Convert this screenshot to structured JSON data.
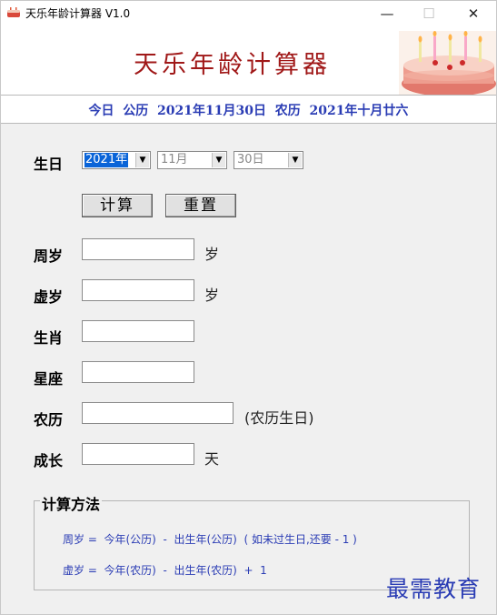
{
  "window": {
    "title": "天乐年龄计算器 V1.0",
    "minimize_glyph": "—",
    "maximize_glyph": "☐",
    "close_glyph": "✕"
  },
  "banner": {
    "title": "天乐年龄计算器"
  },
  "today_line": "今日  公历  2021年11月30日  农历  2021年十月廿六",
  "form": {
    "birthday_label": "生日",
    "year": "2021年",
    "month": "11月",
    "day": "30日",
    "calc_button": "计算",
    "reset_button": "重置",
    "zhousui_label": "周岁",
    "zhousui_value": "",
    "zhousui_unit": "岁",
    "xusui_label": "虚岁",
    "xusui_value": "",
    "xusui_unit": "岁",
    "zodiac_label": "生肖",
    "zodiac_value": "",
    "constellation_label": "星座",
    "constellation_value": "",
    "lunar_label": "农历",
    "lunar_value": "",
    "lunar_note": "(农历生日)",
    "growth_label": "成长",
    "growth_value": "",
    "growth_unit": "天"
  },
  "method": {
    "title": "计算方法",
    "line1": "周岁 =  今年(公历)  -  出生年(公历)  ( 如未过生日,还要 - 1 )",
    "line2": "虚岁 =  今年(农历)  -  出生年(农历)  +  1"
  },
  "watermark": "最需教育",
  "colors": {
    "banner_title": "#a01818",
    "date_text": "#2a3cb4",
    "selection": "#0a64d8"
  }
}
